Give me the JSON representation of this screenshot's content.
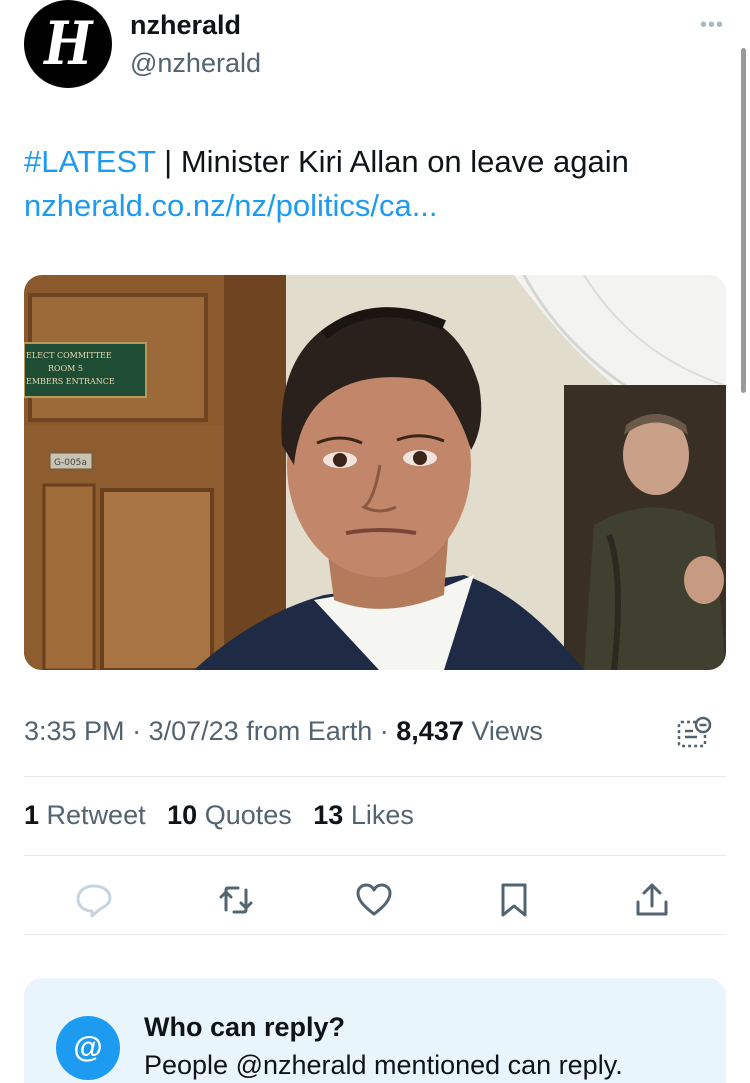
{
  "account": {
    "display_name": "nzherald",
    "handle": "@nzherald",
    "avatar_letter": "H"
  },
  "tweet": {
    "hashtag": "#LATEST",
    "separator": "|",
    "text": "Minister Kiri Allan on leave again",
    "link": "nzherald.co.nz/nz/politics/ca..."
  },
  "media": {
    "sign_lines": [
      "ELECT COMMITTEE",
      "ROOM 5",
      "EMBERS ENTRANCE"
    ],
    "door_plate": "G-005a"
  },
  "meta": {
    "time": "3:35 PM",
    "date": "3/07/23",
    "source": "from Earth",
    "dot": "·",
    "views_count": "8,437",
    "views_label": "Views"
  },
  "stats": {
    "retweets_count": "1",
    "retweets_label": "Retweet",
    "quotes_count": "10",
    "quotes_label": "Quotes",
    "likes_count": "13",
    "likes_label": "Likes"
  },
  "actions": [
    "reply-icon",
    "retweet-icon",
    "like-icon",
    "bookmark-icon",
    "share-icon"
  ],
  "who_can_reply": {
    "title": "Who can reply?",
    "description": "People @nzherald mentioned can reply.",
    "icon": "@"
  },
  "colors": {
    "accent": "#1d9bf0",
    "text": "#0f1419",
    "secondary": "#536471",
    "reply_box_bg": "#e8f5fd"
  }
}
